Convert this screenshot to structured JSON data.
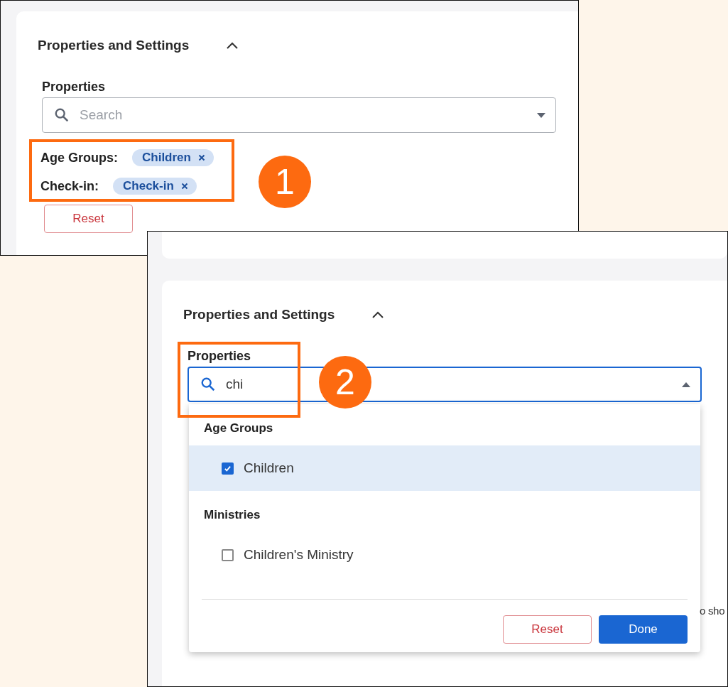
{
  "screens": [
    {
      "title": "Properties and Settings",
      "expanded": true,
      "field": {
        "label": "Properties",
        "placeholder": "Search",
        "focused": false
      },
      "filters": [
        {
          "label": "Age Groups:",
          "tags": [
            "Children"
          ]
        },
        {
          "label": "Check-in:",
          "tags": [
            "Check-in"
          ]
        }
      ],
      "reset": "Reset",
      "callout": "1"
    },
    {
      "title": "Properties and Settings",
      "expanded": true,
      "field": {
        "label": "Properties",
        "value": "chi",
        "focused": true
      },
      "dropdown": {
        "groups": [
          {
            "name": "Age Groups",
            "options": [
              {
                "label": "Children",
                "checked": true
              }
            ]
          },
          {
            "name": "Ministries",
            "options": [
              {
                "label": "Children's Ministry",
                "checked": false
              }
            ]
          }
        ],
        "reset": "Reset",
        "done": "Done"
      },
      "callout": "2",
      "fragments": [
        "o sho"
      ]
    }
  ]
}
